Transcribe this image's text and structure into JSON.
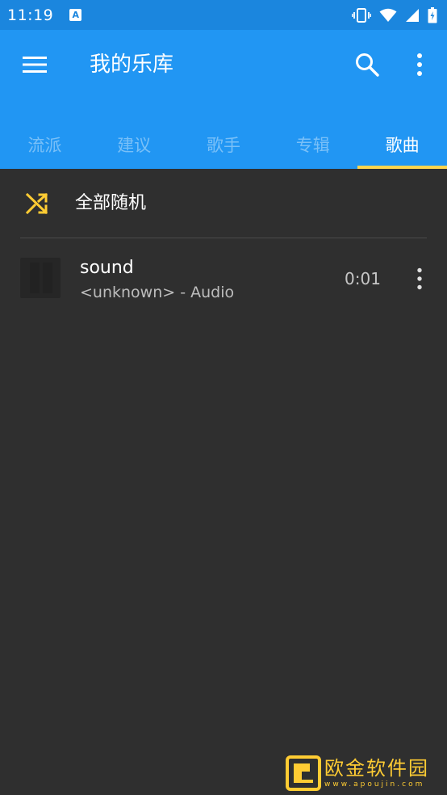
{
  "status_bar": {
    "time": "11:19",
    "app_icon_letter": "A",
    "icons": [
      "vibrate-icon",
      "wifi-icon",
      "signal-icon",
      "battery-icon"
    ]
  },
  "toolbar": {
    "title": "我的乐库",
    "menu_icon": "hamburger-menu-icon",
    "search_icon": "search-icon",
    "more_icon": "more-vert-icon"
  },
  "tabs": [
    {
      "label": "流派",
      "active": false
    },
    {
      "label": "建议",
      "active": false
    },
    {
      "label": "歌手",
      "active": false
    },
    {
      "label": "专辑",
      "active": false
    },
    {
      "label": "歌曲",
      "active": true
    }
  ],
  "shuffle": {
    "label": "全部随机",
    "icon": "shuffle-icon"
  },
  "songs": [
    {
      "title": "sound",
      "subtitle": "<unknown> - Audio",
      "duration": "0:01"
    }
  ],
  "watermark": {
    "main": "欧金软件园",
    "sub": "www.apoujin.com"
  },
  "colors": {
    "status_bar": "#1b86de",
    "app_bar": "#2196f3",
    "accent": "#ffd54f",
    "background": "#2f2f2f"
  }
}
